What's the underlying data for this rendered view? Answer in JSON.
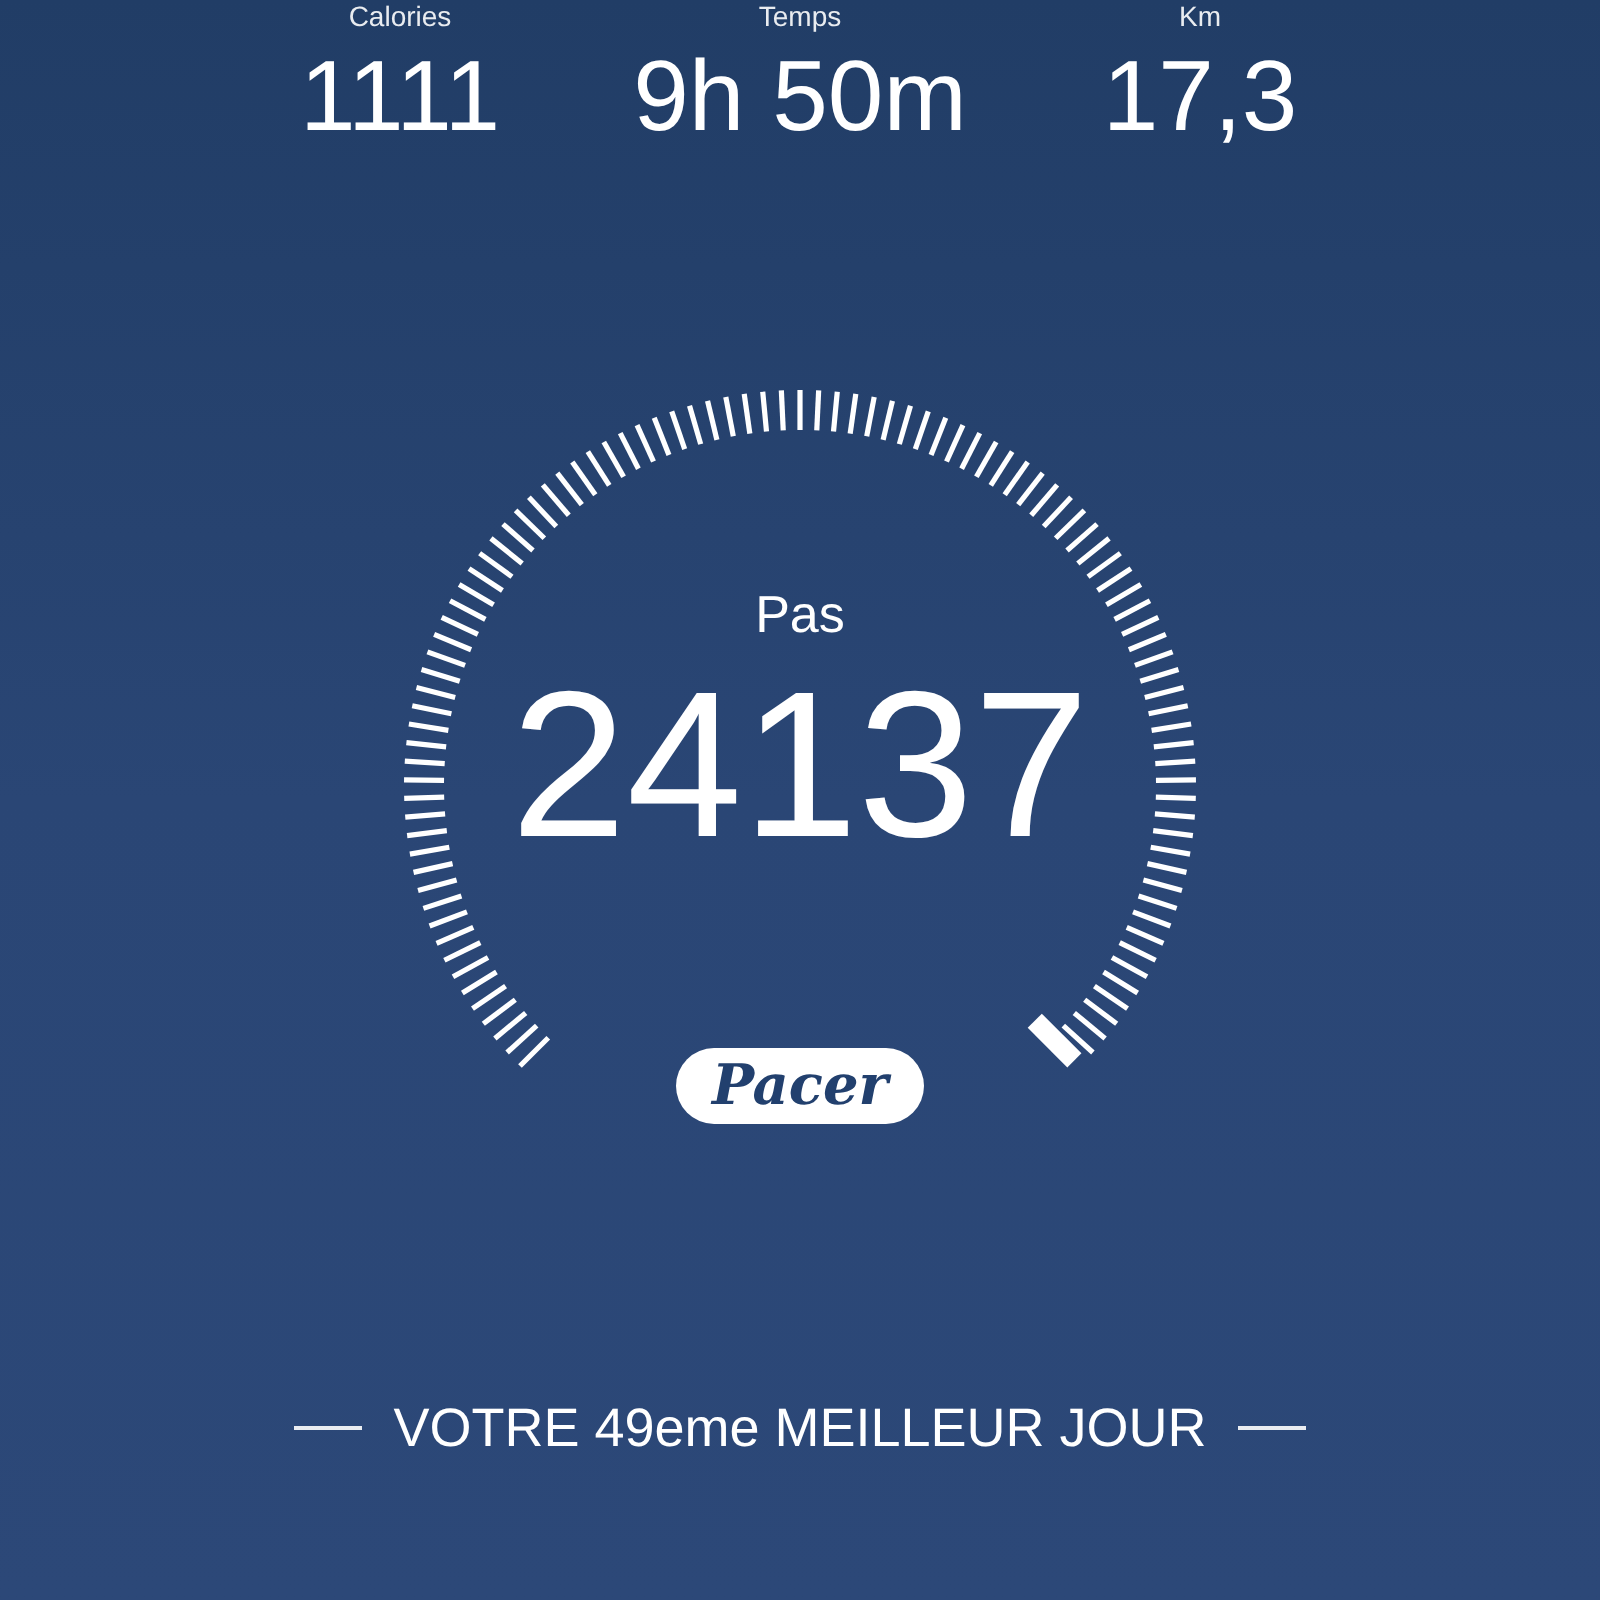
{
  "stats": [
    {
      "label": "Calories",
      "value": "1111"
    },
    {
      "label": "Temps",
      "value": "9h 50m"
    },
    {
      "label": "Km",
      "value": "17,3"
    }
  ],
  "gauge": {
    "label": "Pas",
    "value": "24137"
  },
  "logo": "Pacer",
  "footer": "VOTRE 49eme MEILLEUR JOUR"
}
